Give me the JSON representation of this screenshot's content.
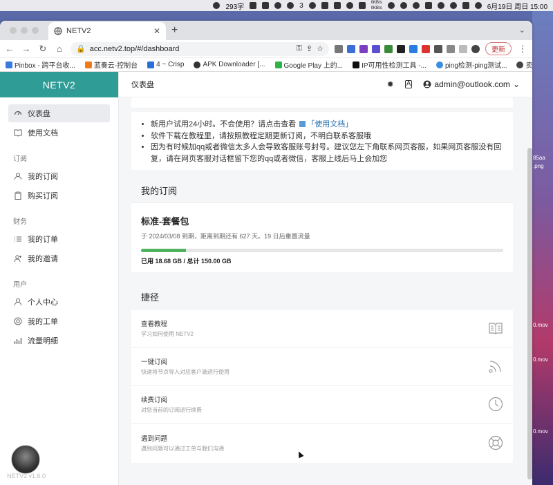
{
  "menubar": {
    "word_count": "293字",
    "net_up": "0KB/s",
    "net_down": "0KB/s",
    "messages_count": "3",
    "date_time": "6月19日 周日 15:00"
  },
  "desktop_files": [
    "85aa",
    ".png",
    "0.mov",
    "0.mov",
    "0.mov"
  ],
  "browser": {
    "tab_title": "NETV2",
    "url": "acc.netv2.top/#/dashboard",
    "update_label": "更新",
    "bookmarks": [
      "Pinbox - 跨平台收...",
      "蓝奏云-控制台",
      "4 ~ Crisp",
      "APK Downloader [...",
      "Google Play 上的...",
      "IP可用性检测工具 -...",
      "ping检测-ping测试...",
      "卖账号的"
    ]
  },
  "sidebar": {
    "brand": "NETV2",
    "top_items": [
      {
        "label": "仪表盘",
        "icon": "dashboard-icon"
      },
      {
        "label": "使用文档",
        "icon": "book-icon"
      }
    ],
    "groups": [
      {
        "title": "订阅",
        "items": [
          {
            "label": "我的订阅",
            "icon": "rss-icon"
          },
          {
            "label": "购买订阅",
            "icon": "clipboard-icon"
          }
        ]
      },
      {
        "title": "财务",
        "items": [
          {
            "label": "我的订单",
            "icon": "list-icon"
          },
          {
            "label": "我的邀请",
            "icon": "user-plus-icon"
          }
        ]
      },
      {
        "title": "用户",
        "items": [
          {
            "label": "个人中心",
            "icon": "user-icon"
          },
          {
            "label": "我的工单",
            "icon": "lifebuoy-icon"
          },
          {
            "label": "流量明细",
            "icon": "bar-chart-icon"
          }
        ]
      }
    ],
    "version": "NETV2 v1.6.0"
  },
  "header": {
    "title": "仪表盘",
    "user": "admin@outlook.com"
  },
  "notice": {
    "items": [
      {
        "before": "新用户试用24小时。不会使用？请点击查看 ",
        "link": "「使用文档」"
      },
      {
        "before": "软件下载在教程里，请按照教程定期更新订阅，不明白联系客服哦",
        "link": ""
      },
      {
        "before": "因为有时候加qq或者微信太多人会导致客服账号封号。建议您左下角联系网页客服，如果网页客服没有回复，请在网页客服对话框留下您的qq或者微信，客服上线后马上会加您",
        "link": ""
      }
    ]
  },
  "subscription": {
    "section_title": "我的订阅",
    "plan_name": "标准-套餐包",
    "expire_text": "于 2024/03/08 到期，距离到期还有 627 天。19 日后重置流量",
    "used_fraction": 0.1245,
    "usage_text": "已用 18.68 GB / 总计 150.00 GB"
  },
  "shortcuts": {
    "section_title": "捷径",
    "items": [
      {
        "title": "查看教程",
        "desc": "学习如何使用 NETV2",
        "icon": "book-open-icon"
      },
      {
        "title": "一键订阅",
        "desc": "快速将节点导入对应客户端进行使用",
        "icon": "rss-icon"
      },
      {
        "title": "续费订阅",
        "desc": "对您当前的订阅进行续费",
        "icon": "clock-icon"
      },
      {
        "title": "遇到问题",
        "desc": "遇到问题可以通过工单与我们沟通",
        "icon": "lifebuoy-icon"
      }
    ]
  }
}
